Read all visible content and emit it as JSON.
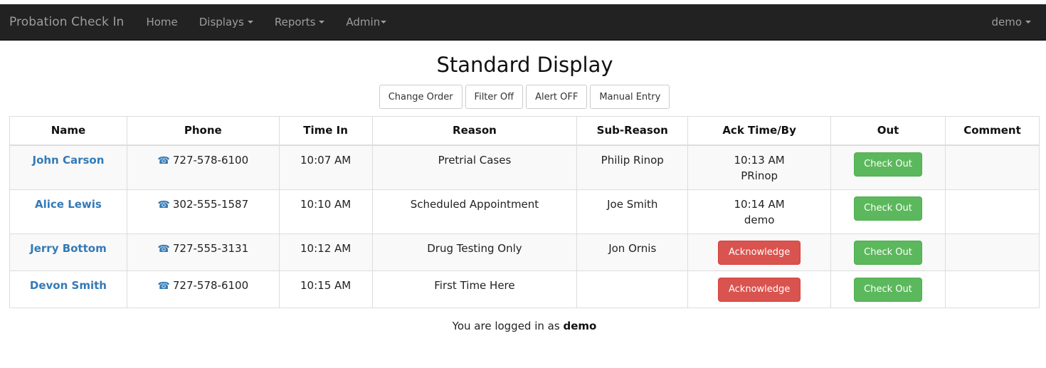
{
  "navbar": {
    "brand": "Probation Check In",
    "items": [
      {
        "label": "Home",
        "dropdown": false
      },
      {
        "label": "Displays",
        "dropdown": true
      },
      {
        "label": "Reports",
        "dropdown": true
      },
      {
        "label": "Admin",
        "dropdown": true
      }
    ],
    "user_menu": {
      "label": "demo",
      "dropdown": true
    }
  },
  "page": {
    "title": "Standard Display"
  },
  "toolbar": {
    "change_order": "Change Order",
    "filter": "Filter Off",
    "alert": "Alert OFF",
    "manual_entry": "Manual Entry"
  },
  "table": {
    "headers": [
      "Name",
      "Phone",
      "Time In",
      "Reason",
      "Sub-Reason",
      "Ack Time/By",
      "Out",
      "Comment"
    ],
    "rows": [
      {
        "name": "John Carson",
        "phone": "727-578-6100",
        "time_in": "10:07 AM",
        "reason": "Pretrial Cases",
        "sub_reason": "Philip Rinop",
        "ack_time": "10:13 AM",
        "ack_by": "PRinop",
        "acknowledged": true,
        "out_label": "Check Out",
        "comment": ""
      },
      {
        "name": "Alice Lewis",
        "phone": "302-555-1587",
        "time_in": "10:10 AM",
        "reason": "Scheduled Appointment",
        "sub_reason": "Joe Smith",
        "ack_time": "10:14 AM",
        "ack_by": "demo",
        "acknowledged": true,
        "out_label": "Check Out",
        "comment": ""
      },
      {
        "name": "Jerry Bottom",
        "phone": "727-555-3131",
        "time_in": "10:12 AM",
        "reason": "Drug Testing Only",
        "sub_reason": "Jon Ornis",
        "ack_label": "Acknowledge",
        "acknowledged": false,
        "out_label": "Check Out",
        "comment": ""
      },
      {
        "name": "Devon Smith",
        "phone": "727-578-6100",
        "time_in": "10:15 AM",
        "reason": "First Time Here",
        "sub_reason": "",
        "ack_label": "Acknowledge",
        "acknowledged": false,
        "out_label": "Check Out",
        "comment": ""
      }
    ]
  },
  "icons": {
    "phone": "☎"
  },
  "footer": {
    "prefix": "You are logged in as ",
    "user": "demo"
  },
  "colors": {
    "navbar_bg": "#222222",
    "link": "#337ab7",
    "success": "#5cb85c",
    "danger": "#d9534f"
  }
}
